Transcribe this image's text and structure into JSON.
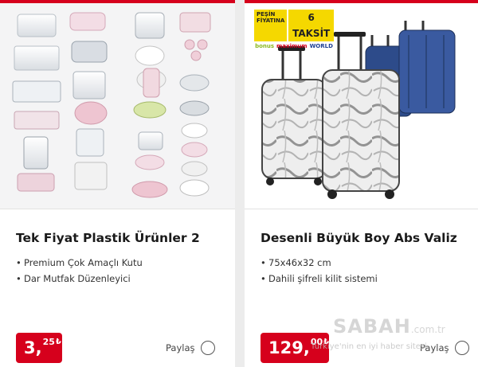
{
  "products": [
    {
      "title": "Tek Fiyat Plastik Ürünler 2",
      "features": [
        "Premium Çok Amaçlı Kutu",
        "Dar Mutfak Düzenleyici"
      ],
      "price": {
        "main": "3,",
        "decimal": "25",
        "currency": "₺"
      },
      "share_label": "Paylaş",
      "image_icon": "plastic-containers-image"
    },
    {
      "title": "Desenli Büyük Boy Abs Valiz",
      "features": [
        "75x46x32 cm",
        "Dahili şifreli kilit sistemi"
      ],
      "price": {
        "main": "129,",
        "decimal": "00",
        "currency": "₺"
      },
      "share_label": "Paylaş",
      "image_icon": "suitcase-image",
      "badge": {
        "line1": "PEŞİN",
        "line2": "FİYATINA",
        "installment": "6 TAKSİT",
        "brands": [
          "bonus",
          "maximum",
          "WORLD"
        ]
      }
    }
  ],
  "watermark": {
    "logo": "SABAH",
    "domain": ".com.tr",
    "tagline": "Türkiye'nin en iyi haber sitesi"
  },
  "colors": {
    "accent": "#d6001c",
    "badge": "#f5d800",
    "background": "#ececec"
  }
}
